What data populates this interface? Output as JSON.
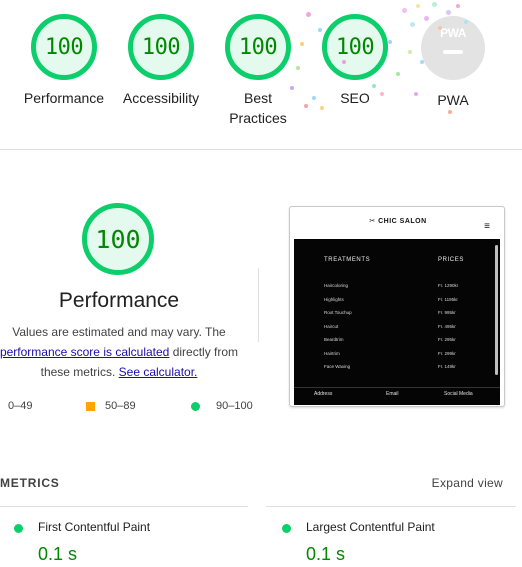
{
  "scores": [
    {
      "value": "100",
      "label_lines": [
        "Performance"
      ]
    },
    {
      "value": "100",
      "label_lines": [
        "Accessibility"
      ]
    },
    {
      "value": "100",
      "label_lines": [
        "Best",
        "Practices"
      ]
    },
    {
      "value": "100",
      "label_lines": [
        "SEO"
      ]
    }
  ],
  "pwa": {
    "badge": "PWA",
    "label": "PWA"
  },
  "performance": {
    "score": "100",
    "title": "Performance",
    "line1": "Values are estimated and may vary. The",
    "link1": "performance score is calculated",
    "line2_rest": " directly from",
    "line3_prefix": "these metrics.",
    "link2": "See calculator."
  },
  "legend": [
    {
      "range": "0–49",
      "shape": "triangle",
      "color": "#ff4e42"
    },
    {
      "range": "50–89",
      "shape": "square",
      "color": "#ffa400"
    },
    {
      "range": "90–100",
      "shape": "circle",
      "color": "#0cce6b"
    }
  ],
  "screenshot": {
    "brand": "✂ CHIC SALON",
    "menu_icon": "≡",
    "col1_header": "TREATMENTS",
    "col2_header": "PRICES",
    "treatments": [
      "Haircoloring",
      "Highlights",
      "Root Touchup",
      "Haircut",
      "Beardtrim",
      "Hairtrim",
      "Face Waxing"
    ],
    "prices": [
      "Fr. 1290kr",
      "Fr. 1195kr",
      "Fr. 995kr",
      "Fr. 495kr",
      "Fr. 295kr",
      "Fr. 299kr",
      "Fr. 149kr"
    ],
    "footer": [
      "Address",
      "Email",
      "Social Media"
    ]
  },
  "metrics": {
    "heading": "METRICS",
    "expand": "Expand view",
    "items": [
      {
        "name": "First Contentful Paint",
        "value": "0.1 s"
      },
      {
        "name": "Largest Contentful Paint",
        "value": "0.1 s"
      }
    ]
  },
  "colors": {
    "pass": "#0cce6b",
    "pass_text": "#008800",
    "average": "#ffa400",
    "fail": "#ff4e42",
    "link": "#1a0dab"
  }
}
